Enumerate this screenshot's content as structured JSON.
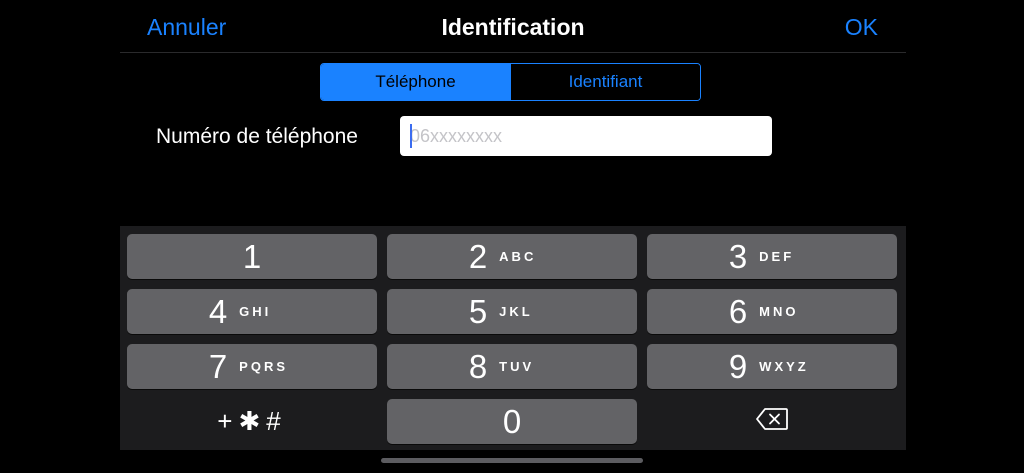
{
  "navbar": {
    "cancel_label": "Annuler",
    "title": "Identification",
    "ok_label": "OK"
  },
  "segmented": {
    "options": [
      {
        "label": "Téléphone",
        "selected": true
      },
      {
        "label": "Identifiant",
        "selected": false
      }
    ]
  },
  "phone_field": {
    "label": "Numéro de téléphone",
    "value": "",
    "placeholder": "06xxxxxxxx"
  },
  "keypad": {
    "keys": [
      {
        "digit": "1",
        "letters": ""
      },
      {
        "digit": "2",
        "letters": "ABC"
      },
      {
        "digit": "3",
        "letters": "DEF"
      },
      {
        "digit": "4",
        "letters": "GHI"
      },
      {
        "digit": "5",
        "letters": "JKL"
      },
      {
        "digit": "6",
        "letters": "MNO"
      },
      {
        "digit": "7",
        "letters": "PQRS"
      },
      {
        "digit": "8",
        "letters": "TUV"
      },
      {
        "digit": "9",
        "letters": "WXYZ"
      },
      {
        "digit": "0",
        "letters": ""
      }
    ],
    "symbols_label": "+✱#",
    "delete_icon": "delete-backspace-icon"
  },
  "colors": {
    "accent": "#1a82ff",
    "background": "#000000",
    "keypad_background": "#1c1c1e",
    "key": "#636366"
  }
}
